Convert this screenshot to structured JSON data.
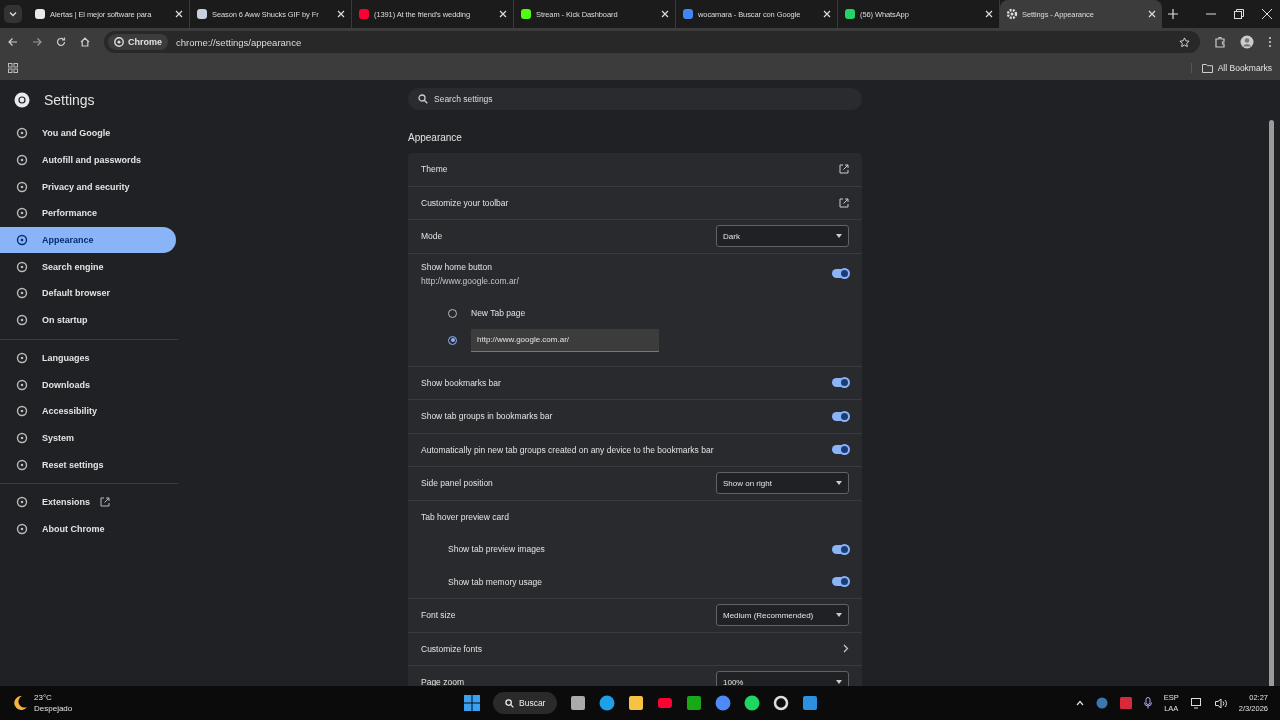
{
  "tabs": [
    {
      "title": "Alertas | El mejor software para",
      "selected": false
    },
    {
      "title": "Season 6 Aww Shucks GIF by Fr",
      "selected": false
    },
    {
      "title": "(1391) At the friend's wedding",
      "selected": false
    },
    {
      "title": "Stream - Kick Dashboard",
      "selected": false
    },
    {
      "title": "wocamara - Buscar con Google",
      "selected": false
    },
    {
      "title": "(56) WhatsApp",
      "selected": false
    },
    {
      "title": "Settings - Appearance",
      "selected": true
    }
  ],
  "toolbar": {
    "chip": "Chrome",
    "url": "chrome://settings/appearance"
  },
  "bookmarks_bar": {
    "all_bookmarks": "All Bookmarks"
  },
  "sidebar": {
    "title": "Settings",
    "groups": [
      [
        {
          "label": "You and Google",
          "selected": false
        },
        {
          "label": "Autofill and passwords",
          "selected": false
        },
        {
          "label": "Privacy and security",
          "selected": false
        },
        {
          "label": "Performance",
          "selected": false
        },
        {
          "label": "Appearance",
          "selected": true
        },
        {
          "label": "Search engine",
          "selected": false
        },
        {
          "label": "Default browser",
          "selected": false
        },
        {
          "label": "On startup",
          "selected": false
        }
      ],
      [
        {
          "label": "Languages",
          "selected": false
        },
        {
          "label": "Downloads",
          "selected": false
        },
        {
          "label": "Accessibility",
          "selected": false
        },
        {
          "label": "System",
          "selected": false
        },
        {
          "label": "Reset settings",
          "selected": false
        }
      ],
      [
        {
          "label": "Extensions",
          "selected": false,
          "kind": "external"
        },
        {
          "label": "About Chrome",
          "selected": false,
          "kind": "plain"
        }
      ]
    ]
  },
  "search": {
    "placeholder": "Search settings"
  },
  "section_title": "Appearance",
  "rows": [
    {
      "kind": "external",
      "label": "Theme"
    },
    {
      "kind": "external",
      "label": "Customize your toolbar"
    },
    {
      "kind": "select",
      "label": "Mode",
      "value": "Dark"
    },
    {
      "kind": "toggle",
      "label": "Show home button",
      "sublabel": "http://www.google.com.ar/",
      "on": true
    },
    {
      "kind": "radios",
      "options": [
        {
          "kind": "text",
          "label": "New Tab page",
          "selected": false
        },
        {
          "kind": "field",
          "value": "http://www.google.com.ar/",
          "selected": true
        }
      ]
    },
    {
      "kind": "toggle",
      "label": "Show bookmarks bar",
      "on": true
    },
    {
      "kind": "toggle",
      "label": "Show tab groups in bookmarks bar",
      "on": true
    },
    {
      "kind": "toggle",
      "label": "Automatically pin new tab groups created on any device to the bookmarks bar",
      "on": true
    },
    {
      "kind": "select",
      "label": "Side panel position",
      "value": "Show on right"
    },
    {
      "kind": "heading",
      "label": "Tab hover preview card"
    },
    {
      "kind": "subtoggle",
      "label": "Show tab preview images",
      "on": true
    },
    {
      "kind": "subtoggle",
      "label": "Show tab memory usage",
      "on": true
    },
    {
      "kind": "select",
      "label": "Font size",
      "value": "Medium (Recommended)"
    },
    {
      "kind": "arrow",
      "label": "Customize fonts"
    },
    {
      "kind": "select",
      "label": "Page zoom",
      "value": "100%"
    }
  ],
  "taskbar": {
    "temperature": "23°C",
    "weather": "Despejado",
    "search": "Buscar",
    "lang_top": "ESP",
    "lang_bottom": "LAA",
    "time": "02:27",
    "date": "2/3/2026"
  }
}
